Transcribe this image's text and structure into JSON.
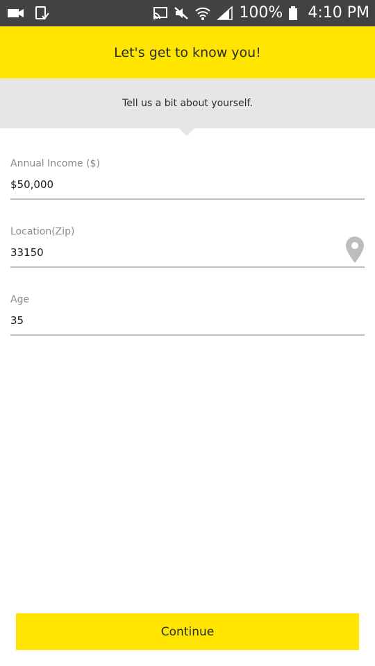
{
  "status_bar": {
    "battery_text": "100%",
    "time": "4:10 PM",
    "left_icons": [
      "video-camera-icon",
      "screenshot-icon"
    ],
    "right_icons": [
      "cast-icon",
      "mute-icon",
      "wifi-icon",
      "signal-icon",
      "battery-icon"
    ]
  },
  "header": {
    "title": "Let's get to know you!"
  },
  "subheader": {
    "text": "Tell us a bit about yourself."
  },
  "form": {
    "income": {
      "label": "Annual Income ($)",
      "value": "$50,000"
    },
    "zip": {
      "label": "Location(Zip)",
      "value": "33150",
      "icon": "location-pin-icon"
    },
    "age": {
      "label": "Age",
      "value": "35"
    }
  },
  "footer": {
    "continue_label": "Continue"
  },
  "colors": {
    "accent": "#ffe500",
    "subheader_bg": "#e6e6e6",
    "status_bar_bg": "#424242",
    "label_gray": "#8a8a8a",
    "underline_gray": "#bdbdbd"
  }
}
